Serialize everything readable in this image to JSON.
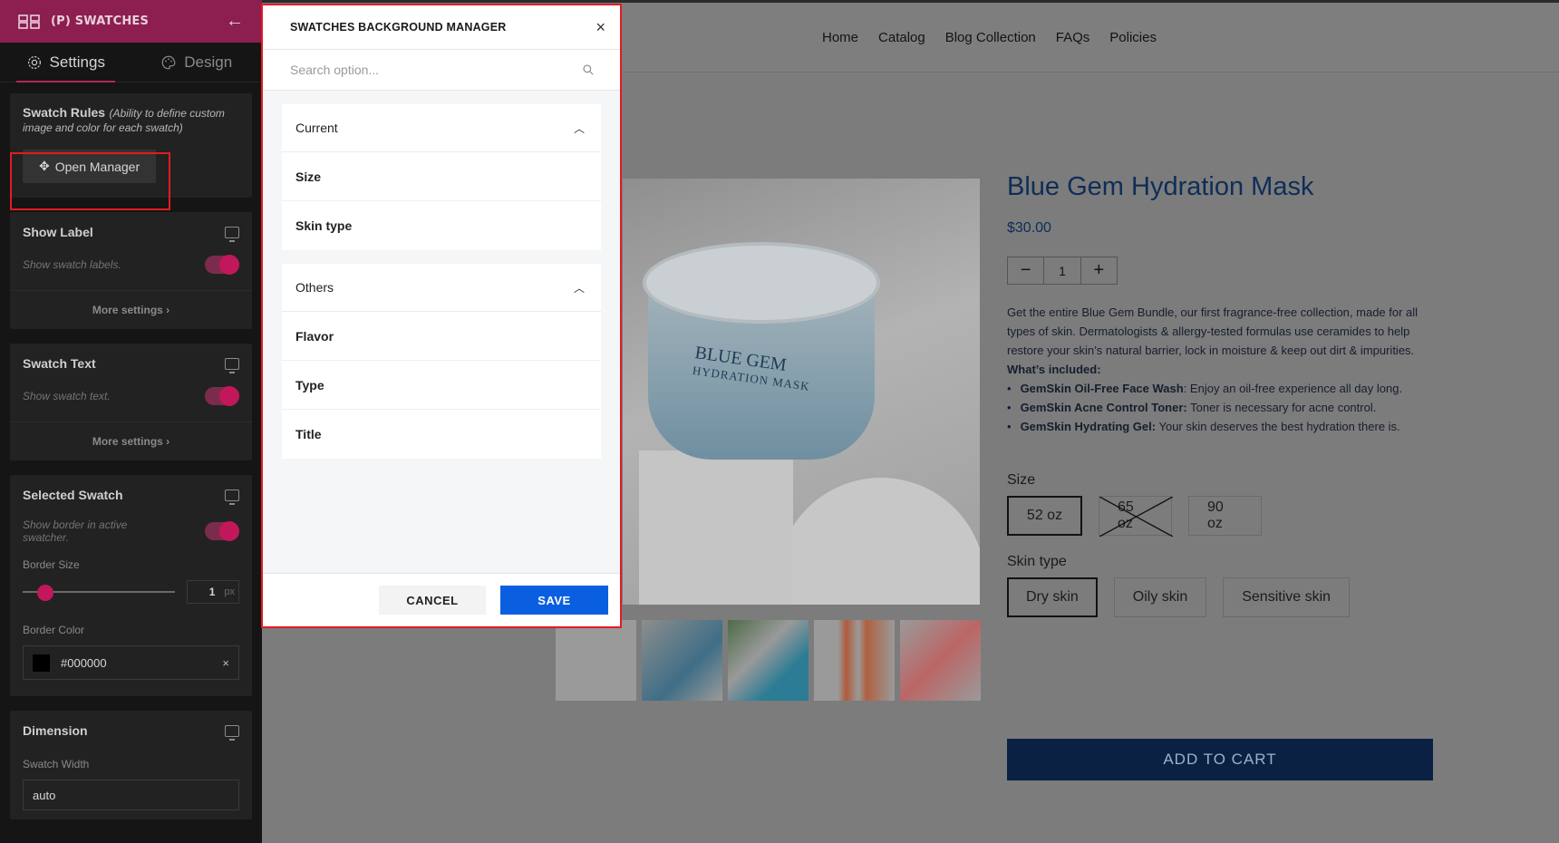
{
  "sidebar": {
    "header_title": "(P) SWATCHES",
    "tabs": [
      {
        "label": "Settings"
      },
      {
        "label": "Design"
      }
    ],
    "swatch_rules": {
      "title": "Swatch Rules",
      "note": "(Ability to define custom image and color for each swatch)",
      "button": "Open Manager"
    },
    "show_label": {
      "title": "Show Label",
      "note": "Show swatch labels.",
      "more": "More settings ›"
    },
    "swatch_text": {
      "title": "Swatch Text",
      "note": "Show swatch text.",
      "more": "More settings ›"
    },
    "selected_swatch": {
      "title": "Selected Swatch",
      "note": "Show border in active swatcher.",
      "border_size_label": "Border Size",
      "border_size_value": "1",
      "border_size_unit": "px",
      "border_color_label": "Border Color",
      "border_color_value": "#000000",
      "clear_icon": "×"
    },
    "dimension": {
      "title": "Dimension",
      "swatch_width_label": "Swatch Width",
      "swatch_width_value": "auto"
    }
  },
  "page": {
    "nav": [
      "Home",
      "Catalog",
      "Blog Collection",
      "FAQs",
      "Policies"
    ],
    "product": {
      "title": "Blue Gem Hydration Mask",
      "price": "$30.00",
      "qty": "1",
      "qty_minus": "−",
      "qty_plus": "+",
      "jar_brand": "BLUE GEM",
      "jar_line": "HYDRATION MASK",
      "description": "Get the entire Blue Gem Bundle, our first fragrance-free collection, made for all types of skin. Dermatologists & allergy-tested formulas use ceramides to help restore your skin’s natural barrier, lock in moisture & keep out dirt & impurities.",
      "included_title": "What’s included:",
      "included": [
        {
          "name": "GemSkin Oil-Free Face Wash",
          "text": ": Enjoy an oil-free experience all day long."
        },
        {
          "name": "GemSkin Acne Control Toner:",
          "text": " Toner is necessary for acne control."
        },
        {
          "name": "GemSkin Hydrating Gel:",
          "text": " Your skin deserves the best hydration there is."
        }
      ],
      "size_label": "Size",
      "sizes": [
        "52 oz",
        "65 oz",
        "90 oz"
      ],
      "skin_label": "Skin type",
      "skins": [
        "Dry skin",
        "Oily skin",
        "Sensitive skin"
      ],
      "add_to_cart": "ADD TO CART"
    }
  },
  "modal": {
    "title": "SWATCHES BACKGROUND MANAGER",
    "close": "×",
    "search_placeholder": "Search option...",
    "groups": [
      {
        "title": "Current",
        "items": [
          "Size",
          "Skin type"
        ]
      },
      {
        "title": "Others",
        "items": [
          "Flavor",
          "Type",
          "Title"
        ]
      }
    ],
    "cancel": "CANCEL",
    "save": "SAVE"
  },
  "colors": {
    "accent": "#c2185b",
    "header": "#8c1f4f",
    "save": "#0a5fe0",
    "highlight": "#e21b23",
    "price": "#0f2d57"
  }
}
